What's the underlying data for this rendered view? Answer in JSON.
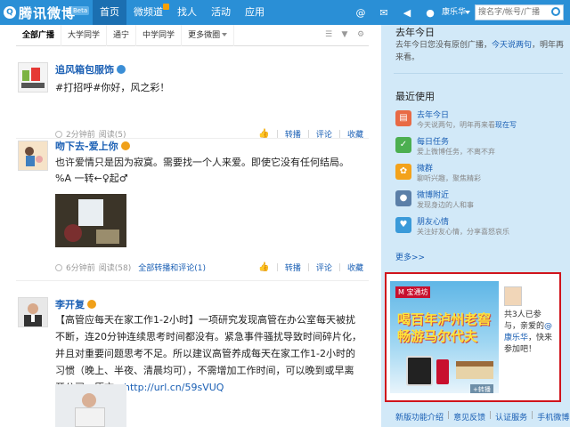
{
  "header": {
    "logo": "腾讯微博",
    "beta": "Beta",
    "nav": [
      "首页",
      "微频道",
      "找人",
      "活动",
      "应用"
    ],
    "user": "康乐华",
    "search_placeholder": "搜名字/帐号/广播"
  },
  "tabs": {
    "items": [
      "全部广播",
      "大学同学",
      "通宁",
      "中学同学",
      "更多微圈"
    ]
  },
  "posts": [
    {
      "name": "追风箱包服饰",
      "text": "#打招呼#你好，风之彩！",
      "time": "2分钟前",
      "read": "阅读(5)",
      "actions": [
        "转播",
        "评论",
        "收藏"
      ]
    },
    {
      "name": "吻下去-爱上你",
      "text": "也许爱情只是因为寂寞。需要找一个人来爱。即使它没有任何结局。%A 一转←♀起♂",
      "time": "6分钟前",
      "read": "阅读(58)",
      "all_link": "全部转播和评论(1)",
      "actions": [
        "转播",
        "评论",
        "收藏"
      ]
    },
    {
      "name": "李开复",
      "text": "【高管应每天在家工作1-2小时】一项研究发现高管在办公室每天被扰不断，连20分钟连续思考时间都没有。紧急事件骚扰导致时间碎片化，并且对重要问题思考不足。所以建议高管养成每天在家工作1-2小时的习惯（晚上、半夜、清晨均可），不需增加工作时间，可以晚到或早离开公司。原文：",
      "url": "http://url.cn/59sVUQ"
    }
  ],
  "sidebar": {
    "today_title": "去年今日",
    "today_text": "去年今日您没有原创广播，",
    "today_link": "今天说两句",
    "today_tail": "，明年再来看。",
    "recent_title": "最近使用",
    "recent": [
      {
        "title": "去年今日",
        "desc_pre": "今天说两句，明年再来看",
        "desc_hl": "现在写",
        "color": "#e86a45"
      },
      {
        "title": "每日任务",
        "desc_pre": "爱上微博任务，不离不弃",
        "desc_hl": "",
        "color": "#4caf50"
      },
      {
        "title": "微群",
        "desc_pre": "聊听兴趣，聚焦精彩",
        "desc_hl": "",
        "color": "#f3a21b"
      },
      {
        "title": "微博附近",
        "desc_pre": "发现身边的人和事",
        "desc_hl": "",
        "color": "#5b7fa8"
      },
      {
        "title": "朋友心情",
        "desc_pre": "关注好友心情，分享喜怒哀乐",
        "desc_hl": "",
        "color": "#3a9ad9"
      }
    ],
    "more": "更多>>"
  },
  "ad": {
    "brand": "M 宝通坊",
    "title": "喝百年泸州老窖 畅游马尔代夫",
    "tag": "+转播",
    "text_pre": "共3人已参与，亲爱的",
    "text_hl": "@康乐华",
    "text_tail": "，快来参加吧！"
  },
  "footer": [
    "新版功能介绍",
    "意见反馈",
    "认证服务",
    "手机微博"
  ]
}
